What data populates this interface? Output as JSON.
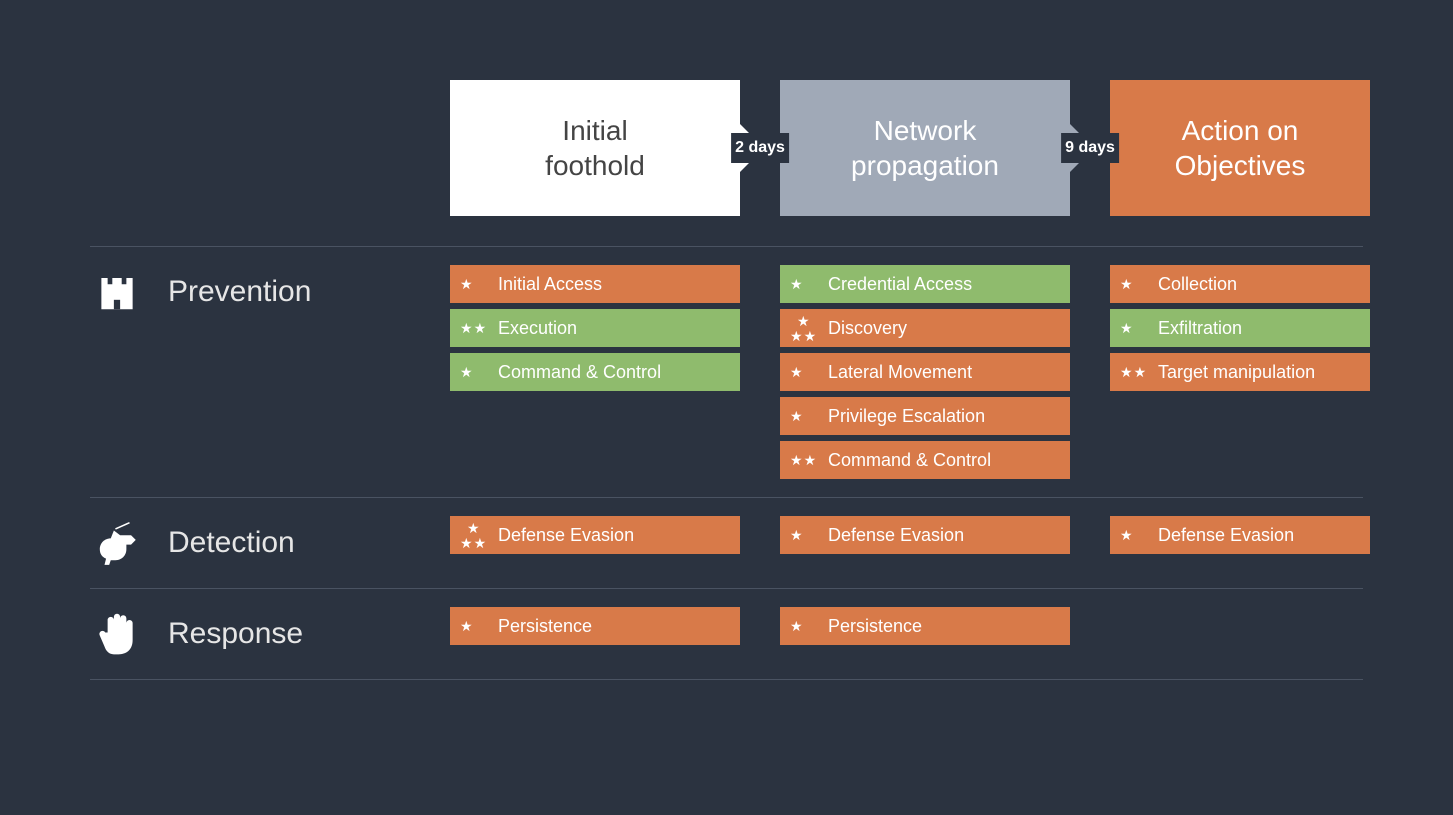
{
  "phases": [
    {
      "key": "initial",
      "label": "Initial\nfoothold",
      "color": "white",
      "gap_label": "2 days"
    },
    {
      "key": "network",
      "label": "Network\npropagation",
      "color": "gray",
      "gap_label": "9 days"
    },
    {
      "key": "action",
      "label": "Action on\nObjectives",
      "color": "orange",
      "gap_label": null
    }
  ],
  "sections": [
    {
      "key": "prevention",
      "label": "Prevention",
      "icon": "castle-icon",
      "cols": [
        [
          {
            "label": "Initial Access",
            "stars": 1,
            "color": "orange"
          },
          {
            "label": "Execution",
            "stars": 2,
            "color": "green"
          },
          {
            "label": "Command & Control",
            "stars": 1,
            "color": "green"
          }
        ],
        [
          {
            "label": "Credential Access",
            "stars": 1,
            "color": "green"
          },
          {
            "label": "Discovery",
            "stars": 3,
            "color": "orange"
          },
          {
            "label": "Lateral Movement",
            "stars": 1,
            "color": "orange"
          },
          {
            "label": "Privilege Escalation",
            "stars": 1,
            "color": "orange"
          },
          {
            "label": "Command & Control",
            "stars": 2,
            "color": "orange"
          }
        ],
        [
          {
            "label": "Collection",
            "stars": 1,
            "color": "orange"
          },
          {
            "label": "Exfiltration",
            "stars": 1,
            "color": "green"
          },
          {
            "label": "Target manipulation",
            "stars": 2,
            "color": "orange"
          }
        ]
      ]
    },
    {
      "key": "detection",
      "label": "Detection",
      "icon": "dog-icon",
      "cols": [
        [
          {
            "label": "Defense Evasion",
            "stars": 3,
            "color": "orange"
          }
        ],
        [
          {
            "label": "Defense Evasion",
            "stars": 1,
            "color": "orange"
          }
        ],
        [
          {
            "label": "Defense Evasion",
            "stars": 1,
            "color": "orange"
          }
        ]
      ]
    },
    {
      "key": "response",
      "label": "Response",
      "icon": "hand-icon",
      "cols": [
        [
          {
            "label": "Persistence",
            "stars": 1,
            "color": "orange"
          }
        ],
        [
          {
            "label": "Persistence",
            "stars": 1,
            "color": "orange"
          }
        ],
        []
      ]
    }
  ]
}
